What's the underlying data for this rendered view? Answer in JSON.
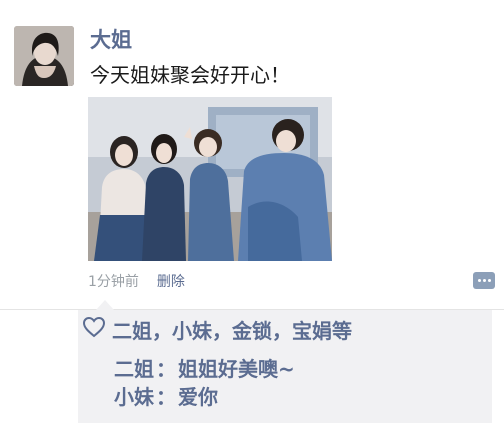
{
  "post": {
    "author": "大姐",
    "text": "今天姐妹聚会好开心！",
    "time": "1分钟前",
    "delete_label": "删除",
    "avatar_icon": "profile-photo",
    "photo_icon": "group-photo"
  },
  "likes": {
    "icon": "heart-outline-icon",
    "names": "二姐，小妹，金锁，宝娟等"
  },
  "comments": [
    {
      "author": "二姐",
      "separator": "：",
      "text": "姐姐好美噢~"
    },
    {
      "author": "小妹",
      "separator": "：",
      "text": "爱你"
    }
  ],
  "colors": {
    "name_blue": "#5b6c91",
    "feedback_bg": "#f1f1f3",
    "meta_gray": "#9aa0a6",
    "comment_button": "#8c9fb8"
  }
}
